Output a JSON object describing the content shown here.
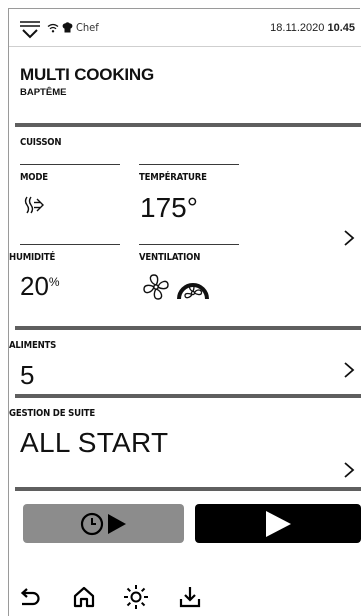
{
  "status_bar": {
    "menu_icon": "menu-dropdown-icon",
    "wifi_icon": "wifi-icon",
    "user_icon": "chef-hat-icon",
    "user": "Chef",
    "date": "18.11.2020",
    "time": "10.45"
  },
  "header": {
    "title": "MULTI COOKING",
    "subtitle": "BAPTÊME"
  },
  "cuisson": {
    "section_label": "CUISSON",
    "mode_label": "MODE",
    "mode_icon": "steam-convection-icon",
    "temperature_label": "TEMPÉRATURE",
    "temperature_value": "175°",
    "humidity_label": "HUMIDITÉ",
    "humidity_value": "20",
    "humidity_unit": "%",
    "ventilation_label": "VENTILATION",
    "ventilation_icons": [
      "fan-icon",
      "fan-speed-gauge-icon"
    ]
  },
  "aliments": {
    "label": "ALIMENTS",
    "value": "5"
  },
  "gestion": {
    "label": "GESTION DE SUITE",
    "value": "ALL START"
  },
  "actions": {
    "delay_start_icons": [
      "clock-icon",
      "play-icon"
    ],
    "start_icon": "play-icon",
    "delay_color": "#8c8c8c",
    "start_color": "#000000"
  },
  "bottom_nav": [
    "back-icon",
    "home-icon",
    "brightness-icon",
    "download-icon"
  ]
}
